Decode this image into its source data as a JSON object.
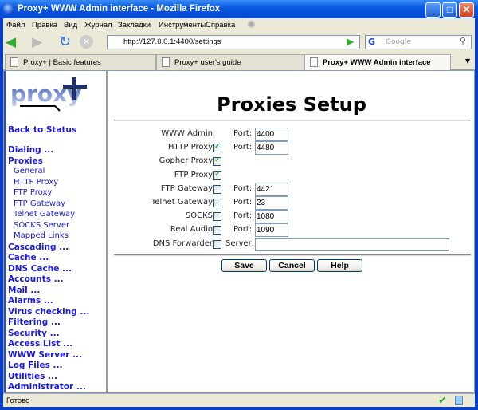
{
  "window": {
    "title": "Proxy+ WWW Admin interface - Mozilla Firefox"
  },
  "menu": [
    "Файл",
    "Правка",
    "Вид",
    "Журнал",
    "Закладки",
    "Инструменты",
    "Справка"
  ],
  "nav": {
    "url": "http://127.0.0.1:4400/settings",
    "search_placeholder": "Google"
  },
  "tabs": [
    {
      "label": "Proxy+ | Basic features"
    },
    {
      "label": "Proxy+ user's guide"
    },
    {
      "label": "Proxy+ WWW Admin interface"
    }
  ],
  "sidebar": {
    "logo": "proxy+",
    "back": "Back to Status",
    "items": [
      {
        "label": "Dialing ...",
        "sub": false
      },
      {
        "label": "Proxies",
        "sub": false
      },
      {
        "label": "General",
        "sub": true
      },
      {
        "label": "HTTP Proxy",
        "sub": true
      },
      {
        "label": "FTP Proxy",
        "sub": true
      },
      {
        "label": "FTP Gateway",
        "sub": true
      },
      {
        "label": "Telnet Gateway",
        "sub": true
      },
      {
        "label": "SOCKS Server",
        "sub": true
      },
      {
        "label": "Mapped Links",
        "sub": true
      },
      {
        "label": "Cascading ...",
        "sub": false
      },
      {
        "label": "Cache ...",
        "sub": false
      },
      {
        "label": "DNS Cache ...",
        "sub": false
      },
      {
        "label": "Accounts ...",
        "sub": false
      },
      {
        "label": "Mail ...",
        "sub": false
      },
      {
        "label": "Alarms ...",
        "sub": false
      },
      {
        "label": "Virus checking ...",
        "sub": false
      },
      {
        "label": "Filtering ...",
        "sub": false
      },
      {
        "label": "Security ...",
        "sub": false
      },
      {
        "label": "Access List ...",
        "sub": false
      },
      {
        "label": "WWW Server ...",
        "sub": false
      },
      {
        "label": "Log Files ...",
        "sub": false
      },
      {
        "label": "Utilities ...",
        "sub": false
      },
      {
        "label": "Administrator ...",
        "sub": false
      }
    ]
  },
  "main": {
    "title": "Proxies Setup",
    "rows": [
      {
        "label": "WWW Admin",
        "checkbox": null,
        "field": "Port:",
        "value": "4400"
      },
      {
        "label": "HTTP Proxy",
        "checkbox": true,
        "field": "Port:",
        "value": "4480"
      },
      {
        "label": "Gopher Proxy",
        "checkbox": true,
        "field": null,
        "value": null
      },
      {
        "label": "FTP Proxy",
        "checkbox": true,
        "field": null,
        "value": null
      },
      {
        "label": "FTP Gateway",
        "checkbox": false,
        "field": "Port:",
        "value": "4421"
      },
      {
        "label": "Telnet Gateway",
        "checkbox": false,
        "field": "Port:",
        "value": "23"
      },
      {
        "label": "SOCKS",
        "checkbox": false,
        "field": "Port:",
        "value": "1080"
      },
      {
        "label": "Real Audio",
        "checkbox": false,
        "field": "Port:",
        "value": "1090"
      },
      {
        "label": "DNS Forwarder",
        "checkbox": false,
        "field": "Server:",
        "value": ""
      }
    ],
    "buttons": {
      "save": "Save",
      "cancel": "Cancel",
      "help": "Help"
    }
  },
  "status": {
    "text": "Готово"
  }
}
